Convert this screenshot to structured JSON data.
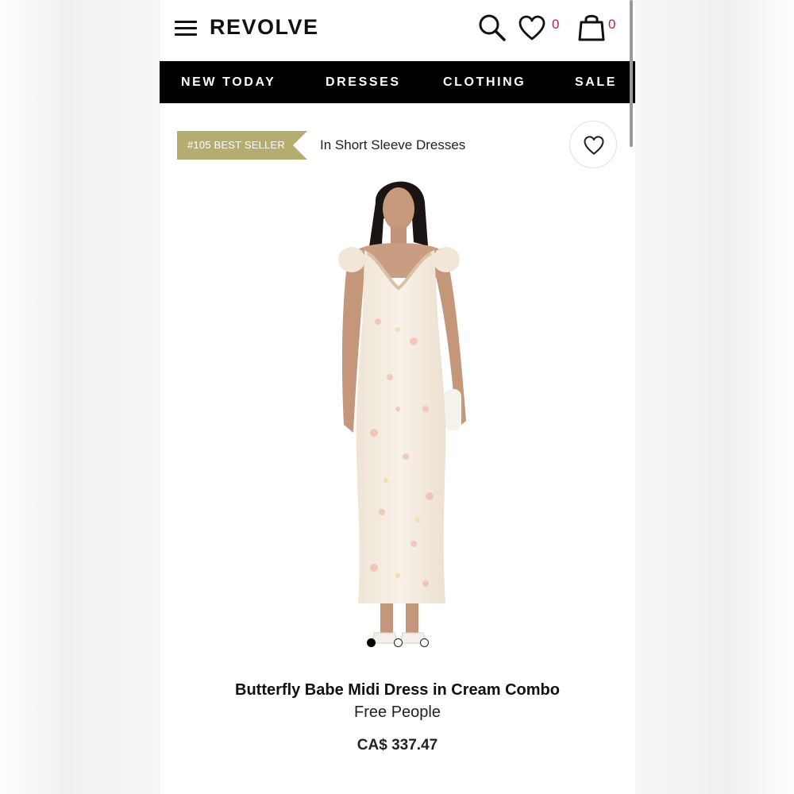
{
  "header": {
    "logo": "REVOLVE",
    "wishlist_count": "0",
    "bag_count": "0"
  },
  "nav": {
    "items": [
      {
        "label": "NEW TODAY"
      },
      {
        "label": "DRESSES"
      },
      {
        "label": "CLOTHING"
      },
      {
        "label": "SALE"
      }
    ]
  },
  "badge": {
    "rank_label": "#105 BEST SELLER",
    "category_label": "In Short Sleeve Dresses"
  },
  "product": {
    "name": "Butterfly Babe Midi Dress in Cream Combo",
    "brand": "Free People",
    "price": "CA$ 337.47",
    "carousel": {
      "total": 3,
      "active": 1
    }
  },
  "colors": {
    "accent": "#b5ad6f",
    "navbar": "#000000",
    "count_badge": "#c2185b"
  },
  "icons": [
    "menu-icon",
    "search-icon",
    "heart-icon",
    "shopping-bag-icon"
  ]
}
